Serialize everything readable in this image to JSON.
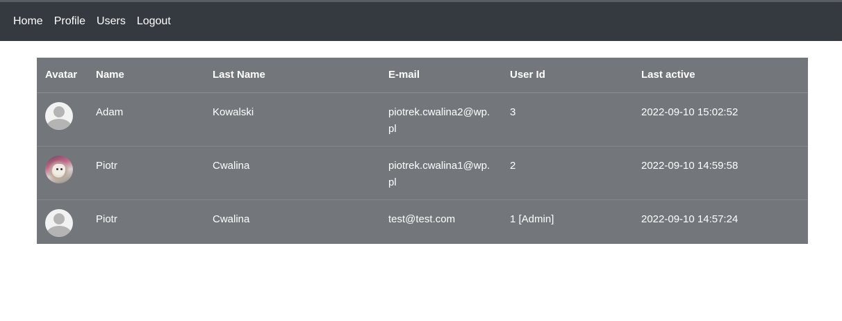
{
  "nav": {
    "items": [
      {
        "label": "Home"
      },
      {
        "label": "Profile"
      },
      {
        "label": "Users"
      },
      {
        "label": "Logout"
      }
    ]
  },
  "table": {
    "headers": {
      "avatar": "Avatar",
      "name": "Name",
      "last_name": "Last Name",
      "email": "E-mail",
      "user_id": "User Id",
      "last_active": "Last active"
    },
    "rows": [
      {
        "avatar": "default-avatar-icon",
        "name": "Adam",
        "last_name": "Kowalski",
        "email": "piotrek.cwalina2@wp.pl",
        "user_id": "3",
        "last_active": "2022-09-10 15:02:52"
      },
      {
        "avatar": "photo-avatar",
        "name": "Piotr",
        "last_name": "Cwalina",
        "email": "piotrek.cwalina1@wp.pl",
        "user_id": "2",
        "last_active": "2022-09-10 14:59:58"
      },
      {
        "avatar": "default-avatar-icon",
        "name": "Piotr",
        "last_name": "Cwalina",
        "email": "test@test.com",
        "user_id": "1 [Admin]",
        "last_active": "2022-09-10 14:57:24"
      }
    ]
  },
  "colors": {
    "navbar_bg": "#343a40",
    "table_bg": "#73777c"
  }
}
